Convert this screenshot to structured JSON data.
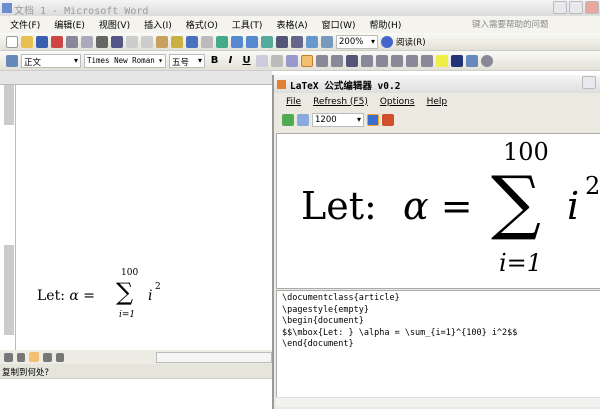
{
  "window": {
    "title": "文档 1 - Microsoft Word"
  },
  "menu": [
    "文件(F)",
    "编辑(E)",
    "视图(V)",
    "插入(I)",
    "格式(O)",
    "工具(T)",
    "表格(A)",
    "窗口(W)",
    "帮助(H)"
  ],
  "help_placeholder": "键入需要帮助的问题",
  "toolbar": {
    "zoom": "200%",
    "read": "阅读(R)"
  },
  "format": {
    "style": "正文",
    "font": "Times New Roman",
    "size": "五号",
    "bold": "B",
    "italic": "I",
    "underline": "U"
  },
  "doc": {
    "let": "Let:",
    "alpha": "α =",
    "sum": "∑",
    "upper": "100",
    "lower": "i=1",
    "term": "i",
    "exp": "2"
  },
  "status": "复制到何处?",
  "latex": {
    "title": "LaTeX 公式编辑器 v0.2",
    "menu": [
      "File",
      "Refresh (F5)",
      "Options",
      "Help"
    ],
    "resolution": "1200",
    "source": "\\documentclass{article}\n\\pagestyle{empty}\n\\begin{document}\n$$\\mbox{Let: } \\alpha = \\sum_{i=1}^{100} i^2$$\n\\end{document}"
  }
}
